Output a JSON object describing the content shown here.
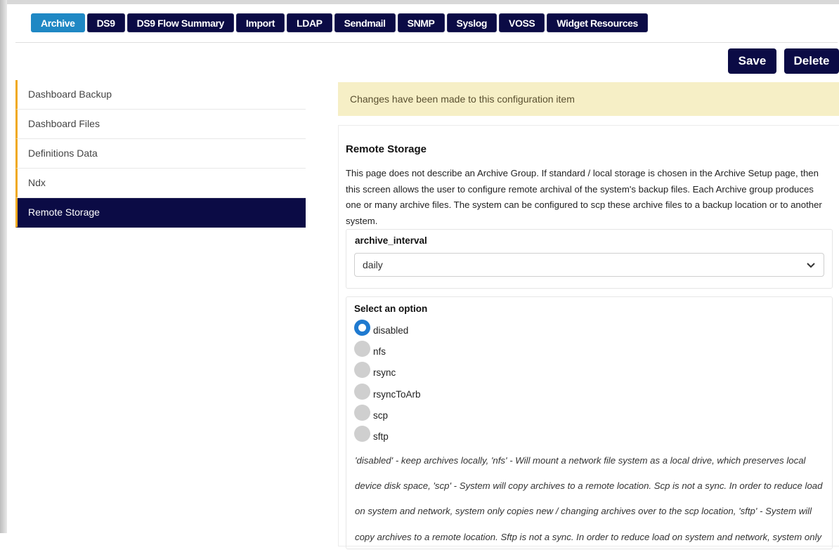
{
  "tabs": [
    "Archive",
    "DS9",
    "DS9 Flow Summary",
    "Import",
    "LDAP",
    "Sendmail",
    "SNMP",
    "Syslog",
    "VOSS",
    "Widget Resources"
  ],
  "active_tab": "Archive",
  "toolbar": {
    "save_label": "Save",
    "delete_label": "Delete"
  },
  "sidebar": {
    "items": [
      {
        "label": "Dashboard Backup"
      },
      {
        "label": "Dashboard Files"
      },
      {
        "label": "Definitions Data"
      },
      {
        "label": "Ndx"
      },
      {
        "label": "Remote Storage"
      }
    ],
    "active": "Remote Storage"
  },
  "notice": "Changes have been made to this configuration item",
  "section": {
    "title": "Remote Storage",
    "description": "This page does not describe an Archive Group. If standard / local storage is chosen in the Archive Setup page, then this screen allows the user to configure remote archival of the system's backup files. Each Archive group produces one or many archive files. The system can be configured to scp these archive files to a backup location or to another system."
  },
  "archive_interval": {
    "label": "archive_interval",
    "value": "daily"
  },
  "option_group": {
    "label": "Select an option",
    "options": [
      "disabled",
      "nfs",
      "rsync",
      "rsyncToArb",
      "scp",
      "sftp"
    ],
    "selected": "disabled",
    "help": "'disabled' - keep archives locally, 'nfs' - Will mount a network file system as a local drive, which preserves local device disk space, 'scp' - System will copy archives to a remote location. Scp is not a sync. In order to reduce load on system and network, system only copies new / changing archives over to the scp location, 'sftp' - System will copy archives to a remote location. Sftp is not a sync. In order to reduce load on system and network, system only"
  },
  "colors": {
    "navy": "#0b0b45",
    "active_tab": "#1f88c4",
    "sidebar_accent": "#f0a91e",
    "notice_bg": "#f6efc6",
    "radio_selected": "#1f7ad0"
  },
  "icons": {
    "select_caret": "chevron-down-icon"
  }
}
